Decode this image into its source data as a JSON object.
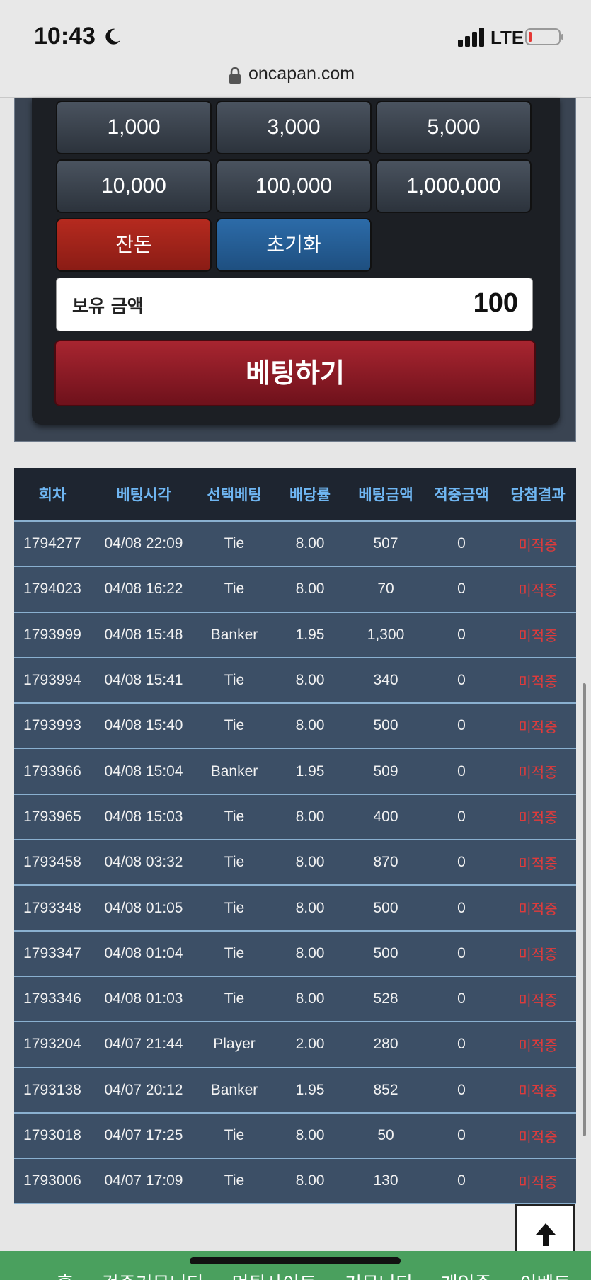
{
  "status_bar": {
    "time": "10:43",
    "network": "LTE"
  },
  "browser": {
    "url": "oncapan.com"
  },
  "chips": {
    "row1": [
      "1,000",
      "3,000",
      "5,000"
    ],
    "row2": [
      "10,000",
      "100,000",
      "1,000,000"
    ],
    "change_label": "잔돈",
    "reset_label": "초기화"
  },
  "balance": {
    "label": "보유 금액",
    "value": "100"
  },
  "bet_button": {
    "label": "베팅하기"
  },
  "table": {
    "headers": [
      "회차",
      "베팅시각",
      "선택베팅",
      "배당률",
      "베팅금액",
      "적중금액",
      "당첨결과"
    ],
    "rows": [
      [
        "1794277",
        "04/08 22:09",
        "Tie",
        "8.00",
        "507",
        "0",
        "미적중"
      ],
      [
        "1794023",
        "04/08 16:22",
        "Tie",
        "8.00",
        "70",
        "0",
        "미적중"
      ],
      [
        "1793999",
        "04/08 15:48",
        "Banker",
        "1.95",
        "1,300",
        "0",
        "미적중"
      ],
      [
        "1793994",
        "04/08 15:41",
        "Tie",
        "8.00",
        "340",
        "0",
        "미적중"
      ],
      [
        "1793993",
        "04/08 15:40",
        "Tie",
        "8.00",
        "500",
        "0",
        "미적중"
      ],
      [
        "1793966",
        "04/08 15:04",
        "Banker",
        "1.95",
        "509",
        "0",
        "미적중"
      ],
      [
        "1793965",
        "04/08 15:03",
        "Tie",
        "8.00",
        "400",
        "0",
        "미적중"
      ],
      [
        "1793458",
        "04/08 03:32",
        "Tie",
        "8.00",
        "870",
        "0",
        "미적중"
      ],
      [
        "1793348",
        "04/08 01:05",
        "Tie",
        "8.00",
        "500",
        "0",
        "미적중"
      ],
      [
        "1793347",
        "04/08 01:04",
        "Tie",
        "8.00",
        "500",
        "0",
        "미적중"
      ],
      [
        "1793346",
        "04/08 01:03",
        "Tie",
        "8.00",
        "528",
        "0",
        "미적중"
      ],
      [
        "1793204",
        "04/07 21:44",
        "Player",
        "2.00",
        "280",
        "0",
        "미적중"
      ],
      [
        "1793138",
        "04/07 20:12",
        "Banker",
        "1.95",
        "852",
        "0",
        "미적중"
      ],
      [
        "1793018",
        "04/07 17:25",
        "Tie",
        "8.00",
        "50",
        "0",
        "미적중"
      ],
      [
        "1793006",
        "04/07 17:09",
        "Tie",
        "8.00",
        "130",
        "0",
        "미적중"
      ]
    ]
  },
  "footer": {
    "items": [
      "홈",
      "검증커뮤니티",
      "먹튀사이트",
      "커뮤니티",
      "게임존",
      "이벤트"
    ]
  },
  "colors": {
    "accent_blue": "#6fb6f2",
    "miss_red": "#e03b3b",
    "footer_green": "#4aa05e"
  }
}
